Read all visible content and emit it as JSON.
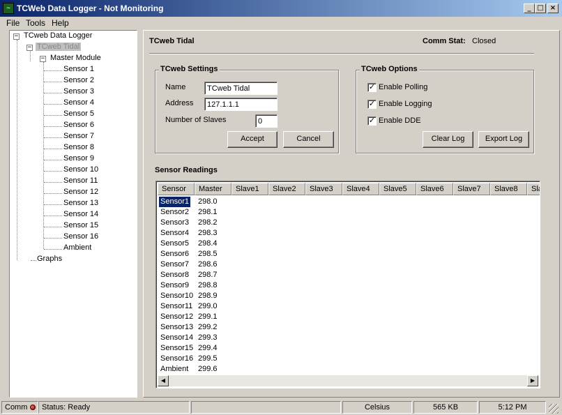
{
  "window": {
    "title": "TCWeb Data Logger - Not Monitoring",
    "icon_text": "~",
    "buttons": {
      "minimize": "_",
      "maximize": "□",
      "close": "×"
    }
  },
  "menu": [
    "File",
    "Tools",
    "Help"
  ],
  "tree": {
    "root": "TCweb Data Logger",
    "device": "TCweb Tidal",
    "module": "Master Module",
    "sensors": [
      "Sensor 1",
      "Sensor 2",
      "Sensor 3",
      "Sensor 4",
      "Sensor 5",
      "Sensor 6",
      "Sensor 7",
      "Sensor 8",
      "Sensor 9",
      "Sensor 10",
      "Sensor 11",
      "Sensor 12",
      "Sensor 13",
      "Sensor 14",
      "Sensor 15",
      "Sensor 16",
      "Ambient"
    ],
    "graphs": "Graphs",
    "expander_minus": "−"
  },
  "main": {
    "device_title": "TCweb Tidal",
    "comm_stat_label": "Comm Stat:",
    "comm_stat_value": "Closed",
    "settings": {
      "title": "TCweb Settings",
      "name_label": "Name",
      "name_value": "TCweb Tidal",
      "address_label": "Address",
      "address_value": "127.1.1.1",
      "slaves_label": "Number of Slaves",
      "slaves_value": "0",
      "accept": "Accept",
      "cancel": "Cancel"
    },
    "options": {
      "title": "TCweb Options",
      "items": [
        {
          "label": "Enable Polling",
          "checked": true
        },
        {
          "label": "Enable Logging",
          "checked": true
        },
        {
          "label": "Enable DDE",
          "checked": true
        }
      ],
      "check_glyph": "✓",
      "clear_log": "Clear Log",
      "export_log": "Export Log"
    },
    "readings_title": "Sensor Readings",
    "grid": {
      "columns": [
        "Sensor",
        "Master",
        "Slave1",
        "Slave2",
        "Slave3",
        "Slave4",
        "Slave5",
        "Slave6",
        "Slave7",
        "Slave8",
        "Sla"
      ],
      "rows": [
        [
          "Sensor1",
          "298.0"
        ],
        [
          "Sensor2",
          "298.1"
        ],
        [
          "Sensor3",
          "298.2"
        ],
        [
          "Sensor4",
          "298.3"
        ],
        [
          "Sensor5",
          "298.4"
        ],
        [
          "Sensor6",
          "298.5"
        ],
        [
          "Sensor7",
          "298.6"
        ],
        [
          "Sensor8",
          "298.7"
        ],
        [
          "Sensor9",
          "298.8"
        ],
        [
          "Sensor10",
          "298.9"
        ],
        [
          "Sensor11",
          "299.0"
        ],
        [
          "Sensor12",
          "299.1"
        ],
        [
          "Sensor13",
          "299.2"
        ],
        [
          "Sensor14",
          "299.3"
        ],
        [
          "Sensor15",
          "299.4"
        ],
        [
          "Sensor16",
          "299.5"
        ],
        [
          "Ambient",
          "299.6"
        ]
      ],
      "scroll_left": "◀",
      "scroll_right": "▶"
    }
  },
  "status": {
    "comm": "Comm",
    "status": "Status: Ready",
    "empty": "",
    "units": "Celsius",
    "memory": "565 KB",
    "time": "5:12 PM"
  }
}
